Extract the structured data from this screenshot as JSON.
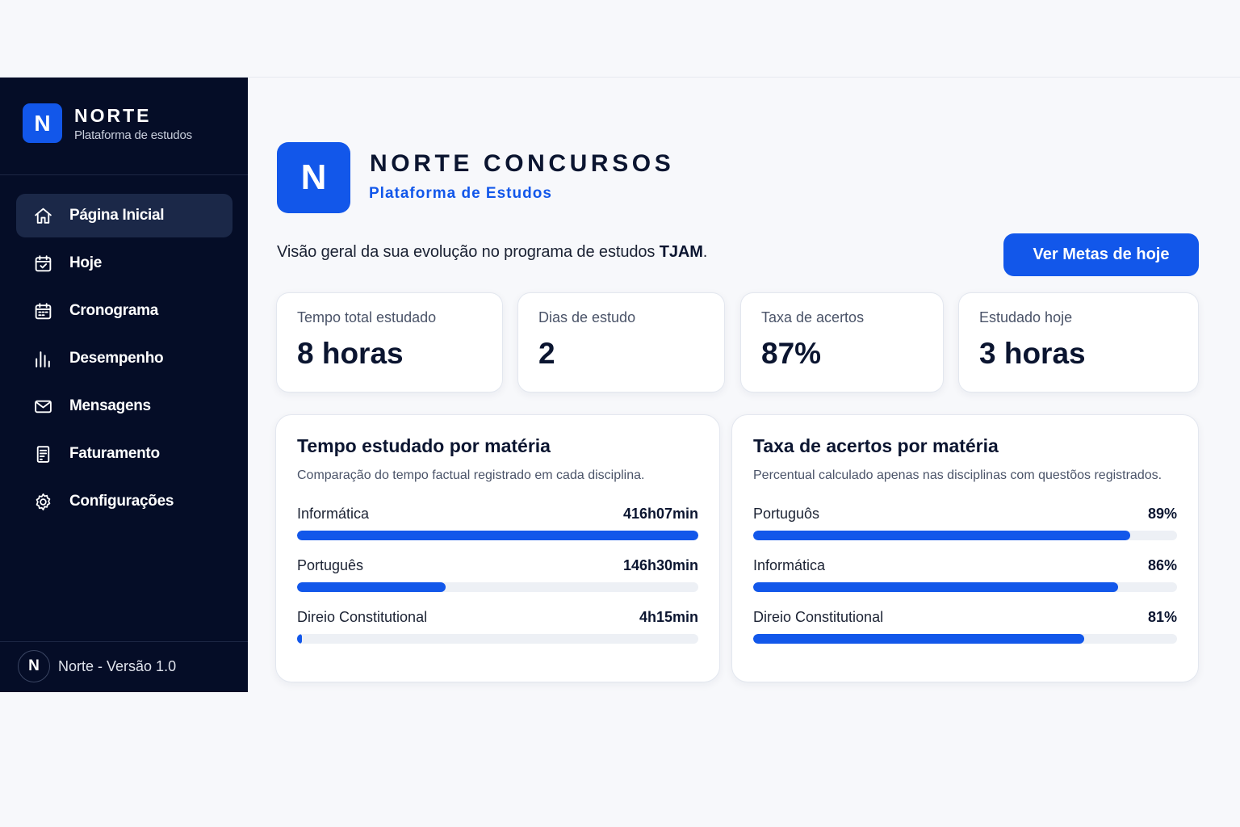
{
  "sidebar": {
    "brand_name": "NORTE",
    "brand_sub": "Plataforma de estudos",
    "brand_logo": "N",
    "items": [
      {
        "label": "Página Inicial",
        "icon": "home-icon",
        "active": true
      },
      {
        "label": "Hoje",
        "icon": "calendar-check-icon",
        "active": false
      },
      {
        "label": "Cronograma",
        "icon": "calendar-icon",
        "active": false
      },
      {
        "label": "Desempenho",
        "icon": "bar-chart-icon",
        "active": false
      },
      {
        "label": "Mensagens",
        "icon": "mail-icon",
        "active": false
      },
      {
        "label": "Faturamento",
        "icon": "receipt-icon",
        "active": false
      },
      {
        "label": "Configurações",
        "icon": "gear-icon",
        "active": false
      }
    ],
    "footer_logo": "N",
    "footer_text": "Norte - Versão 1.0"
  },
  "header": {
    "logo": "N",
    "title": "NORTE CONCURSOS",
    "subtitle": "Plataforma de Estudos",
    "overview_prefix": "Visão geral da sua evolução no programa de estudos ",
    "overview_program": "TJAM",
    "overview_suffix": ".",
    "cta_label": "Ver Metas de hoje"
  },
  "stats": [
    {
      "label": "Tempo total estudado",
      "value": "8 horas"
    },
    {
      "label": "Dias de estudo",
      "value": "2"
    },
    {
      "label": "Taxa de acertos",
      "value": "87%"
    },
    {
      "label": "Estudado hoje",
      "value": "3 horas"
    }
  ],
  "time_panel": {
    "title": "Tempo estudado por matéria",
    "description": "Comparação do tempo factual registrado em cada disciplina.",
    "rows": [
      {
        "name": "Informática",
        "value": "416h07min",
        "fraction": 1.0
      },
      {
        "name": "Português",
        "value": "146h30min",
        "fraction": 0.37
      },
      {
        "name": "Direio Constitutional",
        "value": "4h15min",
        "fraction": 0.013
      }
    ]
  },
  "accuracy_panel": {
    "title": "Taxa de acertos por matéria",
    "description": "Percentual calculado apenas nas disciplinas com questõos registrados.",
    "rows": [
      {
        "name": "Portuguôs",
        "value": "89%",
        "fraction": 0.89
      },
      {
        "name": "Informática",
        "value": "86%",
        "fraction": 0.86
      },
      {
        "name": "Direio Constitutional",
        "value": "81%",
        "fraction": 0.78
      }
    ]
  },
  "colors": {
    "sidebar_bg": "#050d27",
    "accent": "#1257ea",
    "active_nav_bg": "#1b2848"
  }
}
